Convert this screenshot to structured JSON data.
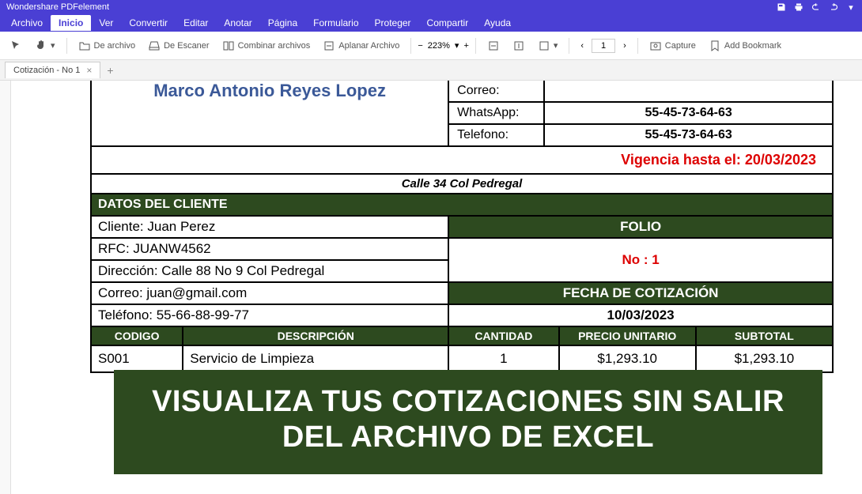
{
  "app": {
    "title": "Wondershare PDFelement"
  },
  "menubar": {
    "items": [
      "Archivo",
      "Inicio",
      "Ver",
      "Convertir",
      "Editar",
      "Anotar",
      "Página",
      "Formulario",
      "Proteger",
      "Compartir",
      "Ayuda"
    ],
    "active_index": 1
  },
  "toolbar": {
    "from_file": "De archivo",
    "from_scanner": "De Escaner",
    "combine": "Combinar archivos",
    "flatten": "Aplanar Archivo",
    "zoom": "223%",
    "page_current": "1",
    "capture": "Capture",
    "bookmark": "Add Bookmark"
  },
  "tab": {
    "title": "Cotización - No 1"
  },
  "document": {
    "vendor_name": "Marco Antonio Reyes Lopez",
    "contacts": {
      "correo_label": "Correo:",
      "whatsapp_label": "WhatsApp:",
      "whatsapp_value": "55-45-73-64-63",
      "telefono_label": "Telefono:",
      "telefono_value": "55-45-73-64-63"
    },
    "vigencia_label": "Vigencia hasta el: 20/03/2023",
    "address": "Calle 34 Col Pedregal",
    "section_client": "DATOS DEL CLIENTE",
    "client": {
      "nombre": "Cliente: Juan Perez",
      "rfc": "RFC: JUANW4562",
      "direccion": "Dirección: Calle 88 No 9 Col Pedregal",
      "correo": "Correo: juan@gmail.com",
      "telefono": "Teléfono: 55-66-88-99-77"
    },
    "folio_label": "FOLIO",
    "folio_no": "No : 1",
    "fecha_label": "FECHA DE COTIZACIÓN",
    "fecha_value": "10/03/2023",
    "columns": {
      "codigo": "CODIGO",
      "descripcion": "DESCRIPCIÓN",
      "cantidad": "CANTIDAD",
      "precio": "PRECIO UNITARIO",
      "subtotal": "SUBTOTAL"
    },
    "items": [
      {
        "codigo": "S001",
        "descripcion": "Servicio de Limpieza",
        "cantidad": "1",
        "precio": "$1,293.10",
        "subtotal": "$1,293.10"
      }
    ]
  },
  "overlay": "VISUALIZA TUS COTIZACIONES SIN SALIR DEL ARCHIVO DE EXCEL"
}
